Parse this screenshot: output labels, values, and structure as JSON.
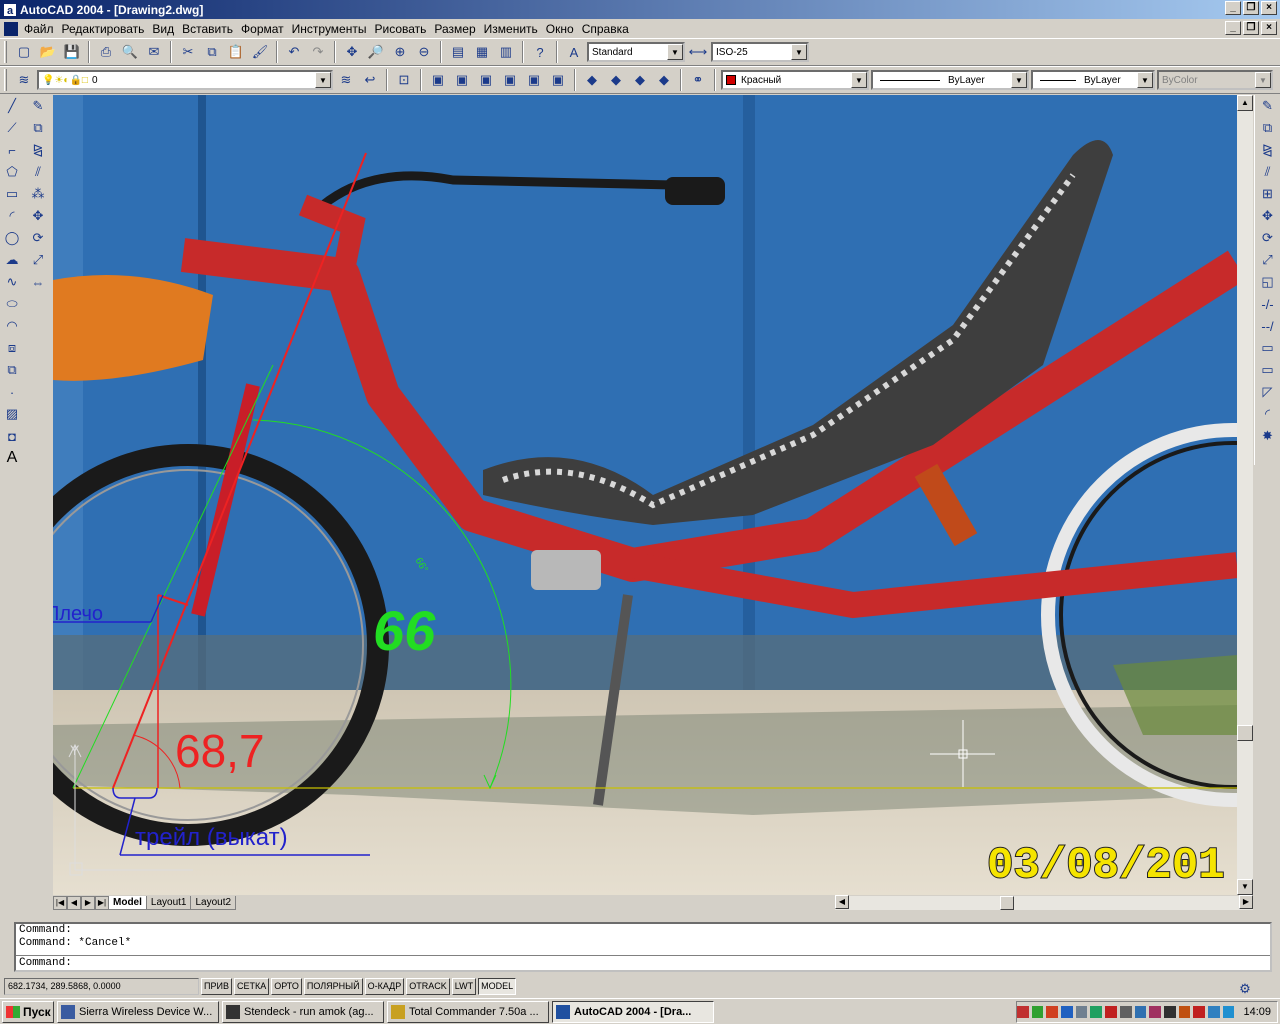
{
  "window": {
    "title": "AutoCAD 2004 - [Drawing2.dwg]",
    "app_icon": "autocad-icon"
  },
  "menu": {
    "items": [
      "Файл",
      "Редактировать",
      "Вид",
      "Вставить",
      "Формат",
      "Инструменты",
      "Рисовать",
      "Размер",
      "Изменить",
      "Окно",
      "Справка"
    ]
  },
  "toolbar": {
    "text_style": "Standard",
    "dim_style": "ISO-25",
    "layer": "0",
    "color": "Красный",
    "color_hex": "#d00000",
    "linetype": "ByLayer",
    "lineweight": "ByLayer",
    "plotstyle": "ByColor"
  },
  "drawing": {
    "label_shoulder": "Плечо",
    "label_angle_large": "66",
    "label_angle_dim": "66°",
    "label_angle_red": "68,7",
    "label_trail": "трейл (выкат)",
    "photo_date": "03/08/201",
    "colors": {
      "green": "#22dd22",
      "red": "#ee2222",
      "blue": "#2222cc",
      "date": "#f5e400"
    }
  },
  "tabs": {
    "model": "Model",
    "layout1": "Layout1",
    "layout2": "Layout2"
  },
  "command": {
    "line1": "Command:",
    "line2": "Command: *Cancel*",
    "prompt": "Command:"
  },
  "status": {
    "coords": "682.1734, 289.5868, 0.0000",
    "buttons": [
      "ПРИВ",
      "СЕТКА",
      "ОРТО",
      "ПОЛЯРНЫЙ",
      "О-КАДР",
      "OTRACK",
      "LWT",
      "MODEL"
    ]
  },
  "taskbar": {
    "start": "Пуск",
    "tasks": [
      "Sierra Wireless Device W...",
      "Stendeck - run amok (ag...",
      "Total Commander 7.50a ...",
      "AutoCAD 2004 - [Dra..."
    ],
    "clock": "14:09"
  }
}
